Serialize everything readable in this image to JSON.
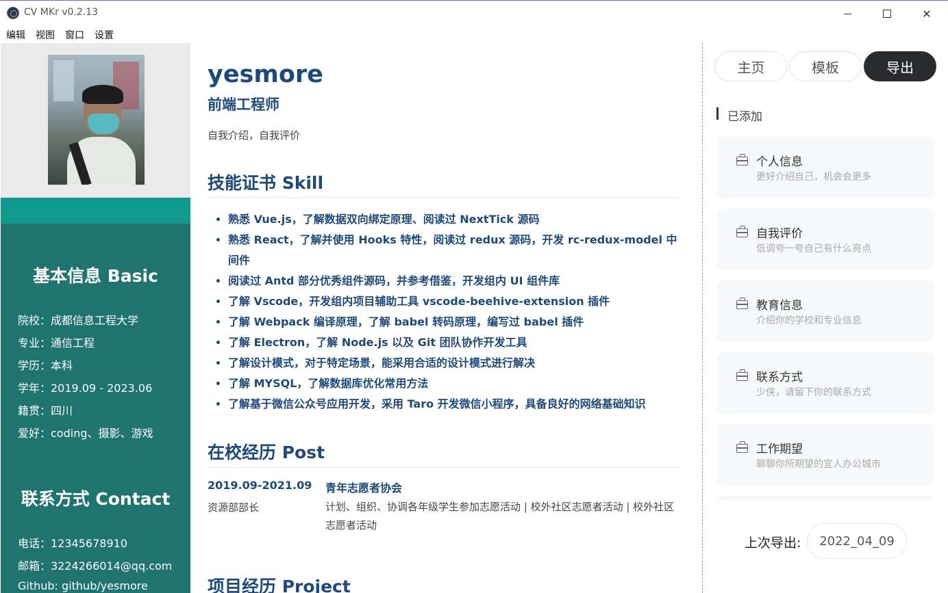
{
  "window": {
    "title": "CV MKr v0.2.13",
    "minimize": "",
    "maximize": "",
    "close": "✕"
  },
  "menu": [
    "编辑",
    "视图",
    "窗口",
    "设置"
  ],
  "resume": {
    "name": "yesmore",
    "job": "前端工程师",
    "intro": "自我介绍，自我评价",
    "basic_title": "基本信息 Basic",
    "basic_info": [
      "院校：成都信息工程大学",
      "专业：通信工程",
      "学历：本科",
      "学年：2019.09 - 2023.06",
      "籍贯：四川",
      "爱好：coding、摄影、游戏"
    ],
    "contact_title": "联系方式 Contact",
    "contact": [
      "电话：12345678910",
      "邮箱：3224266014@qq.com",
      "Github: github/yesmore"
    ],
    "skill_title": "技能证书 Skill",
    "skills": [
      "熟悉 Vue.js，了解数据双向绑定原理、阅读过 NextTick 源码",
      "熟悉 React，了解并使用 Hooks 特性，阅读过 redux 源码，开发 rc-redux-model 中间件",
      "阅读过 Antd 部分优秀组件源码，并参考借鉴，开发组内 UI 组件库",
      "了解 Vscode，开发组内项目辅助工具 vscode-beehive-extension 插件",
      "了解 Webpack 编译原理，了解 babel 转码原理，编写过 babel 插件",
      "了解 Electron，了解 Node.js 以及 Git 团队协作开发工具",
      "了解设计模式，对于特定场景，能采用合适的设计模式进行解决",
      "了解 MYSQL，了解数据库优化常用方法",
      "了解基于微信公众号应用开发，采用 Taro 开发微信小程序，具备良好的网络基础知识"
    ],
    "post_title": "在校经历 Post",
    "post": {
      "date": "2019.09-2021.09",
      "org": "青年志愿者协会",
      "role": "资源部部长",
      "desc": "计划、组织、协调各年级学生参加志愿活动 | 校外社区志愿者活动 | 校外社区志愿者活动"
    },
    "project_title": "项目经历 Project"
  },
  "panel": {
    "tabs": [
      "主页",
      "模板",
      "导出"
    ],
    "active_tab": "导出",
    "added_label": "已添加",
    "cards": [
      {
        "title": "个人信息",
        "sub": "更好介绍自己，机会会更多"
      },
      {
        "title": "自我评价",
        "sub": "低调夸一夸自己有什么亮点"
      },
      {
        "title": "教育信息",
        "sub": "介绍你的学校和专业信息"
      },
      {
        "title": "联系方式",
        "sub": "少侠，请留下你的联系方式"
      },
      {
        "title": "工作期望",
        "sub": "聊聊你所期望的宜人办公城市"
      }
    ],
    "last_export_label": "上次导出:",
    "last_export_value": "2022_04_09"
  },
  "colors": {
    "sidebar": "#1f7470",
    "band": "#0e9a8e",
    "heading": "#1e4a7a",
    "active_tab": "#2a2b2e"
  }
}
